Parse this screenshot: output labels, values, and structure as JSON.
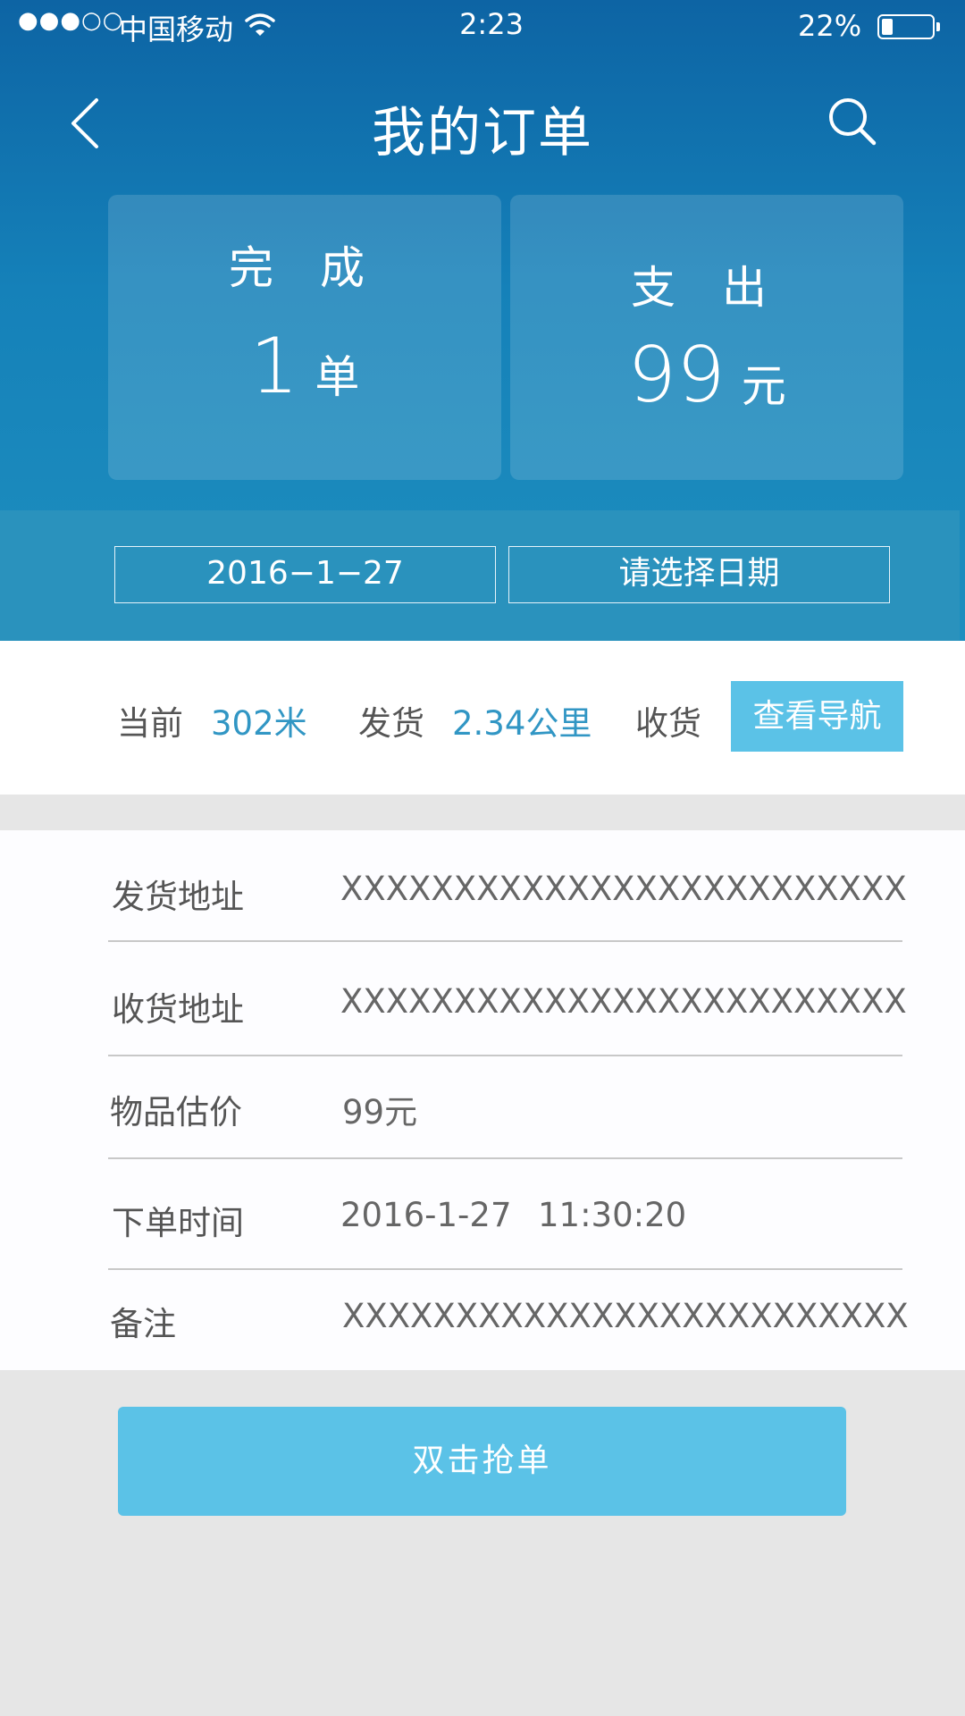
{
  "status_bar": {
    "signal": "●●●○○",
    "carrier": "中国移动",
    "time": "2:23",
    "battery_percent": "22%",
    "battery_level": 0.22
  },
  "nav": {
    "title": "我的订单",
    "back_icon": "chevron-left-icon",
    "search_icon": "search-icon"
  },
  "stats": {
    "completed_label": "完 成",
    "completed_value": "1",
    "completed_unit": "单",
    "expense_label": "支 出",
    "expense_value": "99",
    "expense_unit": "元"
  },
  "dates": {
    "start_date": "2016−1−27",
    "end_placeholder": "请选择日期"
  },
  "distance": {
    "current_label": "当前",
    "current_value": "302米",
    "ship_label": "发货",
    "ship_value": "2.34公里",
    "receive_label": "收货",
    "nav_button": "查看导航"
  },
  "details": {
    "ship_address_label": "发货地址",
    "ship_address_value": "XXXXXXXXXXXXXXXXXXXXXXXXX",
    "receive_address_label": "收货地址",
    "receive_address_value": "XXXXXXXXXXXXXXXXXXXXXXXXX",
    "item_value_label": "物品估价",
    "item_value_value": "99元",
    "order_time_label": "下单时间",
    "order_time_date": "2016-1-27",
    "order_time_time": "11:30:20",
    "remark_label": "备注",
    "remark_value": "XXXXXXXXXXXXXXXXXXXXXXXXX"
  },
  "action": {
    "grab_button": "双击抢单"
  },
  "colors": {
    "header_top": "#0d64a4",
    "header_bottom": "#1e8fbf",
    "accent": "#5bc2e7",
    "distance_value": "#3196c4",
    "background": "#e6e6e6"
  }
}
